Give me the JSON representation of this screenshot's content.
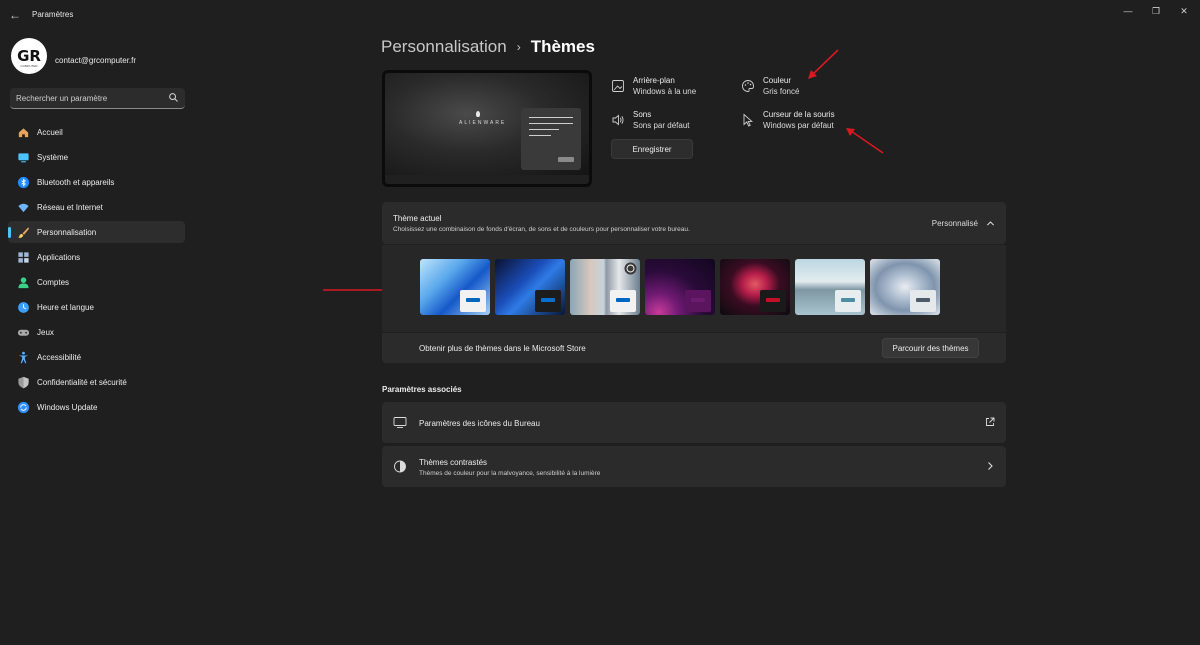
{
  "window": {
    "title": "Paramètres",
    "back_glyph": "←",
    "minimize_glyph": "—",
    "maximize_glyph": "❐",
    "close_glyph": "✕"
  },
  "account": {
    "avatar_mark": "GR",
    "avatar_sub": "COMPUTER",
    "email": "contact@grcomputer.fr"
  },
  "search": {
    "placeholder": "Rechercher un paramètre"
  },
  "sidebar": {
    "items": [
      {
        "label": "Accueil",
        "icon": "home-icon",
        "color": "#e8a35c"
      },
      {
        "label": "Système",
        "icon": "system-icon",
        "color": "#4cc2ff"
      },
      {
        "label": "Bluetooth et appareils",
        "icon": "bluetooth-icon",
        "color": "#1f8bff"
      },
      {
        "label": "Réseau et Internet",
        "icon": "wifi-icon",
        "color": "#6cb6ff"
      },
      {
        "label": "Personnalisation",
        "icon": "brush-icon",
        "color": "#e9a46a",
        "active": true
      },
      {
        "label": "Applications",
        "icon": "apps-icon",
        "color": "#9fb7d6"
      },
      {
        "label": "Comptes",
        "icon": "accounts-icon",
        "color": "#3bd187"
      },
      {
        "label": "Heure et langue",
        "icon": "globe-clock-icon",
        "color": "#3aa0ff"
      },
      {
        "label": "Jeux",
        "icon": "gamepad-icon",
        "color": "#a8a8a8"
      },
      {
        "label": "Accessibilité",
        "icon": "accessibility-icon",
        "color": "#5ab0ff"
      },
      {
        "label": "Confidentialité et sécurité",
        "icon": "shield-icon",
        "color": "#9a9a9a"
      },
      {
        "label": "Windows Update",
        "icon": "update-icon",
        "color": "#2f8fff"
      }
    ]
  },
  "breadcrumb": {
    "parent": "Personnalisation",
    "separator": "›",
    "current": "Thèmes"
  },
  "preview": {
    "brand": "ALIENWARE"
  },
  "properties": {
    "background": {
      "title": "Arrière-plan",
      "value": "Windows à la une",
      "icon": "image-icon"
    },
    "color": {
      "title": "Couleur",
      "value": "Gris foncé",
      "icon": "palette-icon"
    },
    "sounds": {
      "title": "Sons",
      "value": "Sons par défaut",
      "icon": "speaker-icon"
    },
    "cursor": {
      "title": "Curseur de la souris",
      "value": "Windows par défaut",
      "icon": "cursor-icon"
    },
    "save_label": "Enregistrer"
  },
  "current_theme": {
    "title": "Thème actuel",
    "subtitle": "Choisissez une combinaison de fonds d'écran, de sons et de couleurs pour personnaliser votre bureau.",
    "value": "Personnalisé",
    "themes": [
      {
        "name": "windows-light-theme",
        "accent": "#0067c0",
        "mini": "#f2f2f2"
      },
      {
        "name": "windows-dark-theme",
        "accent": "#0a6ed1",
        "mini": "#1c1c1c"
      },
      {
        "name": "windows-spotlight-theme",
        "accent": "#0067c0",
        "mini": "#f2f2f2"
      },
      {
        "name": "glow-theme",
        "accent": "#6b1c6f",
        "mini": "#5a155e"
      },
      {
        "name": "captured-motion-theme",
        "accent": "#c40f28",
        "mini": "#1a1a1a"
      },
      {
        "name": "sunrise-theme",
        "accent": "#4c8fa3",
        "mini": "#e8eef0"
      },
      {
        "name": "flow-theme",
        "accent": "#4d5b68",
        "mini": "#e6e9ec"
      }
    ],
    "store_label": "Obtenir plus de thèmes dans le Microsoft Store",
    "browse_label": "Parcourir des thèmes"
  },
  "related": {
    "title": "Paramètres associés",
    "items": [
      {
        "title": "Paramètres des icônes du Bureau",
        "subtitle": "",
        "icon": "desktop-icon",
        "action": "external-link-icon"
      },
      {
        "title": "Thèmes contrastés",
        "subtitle": "Thèmes de couleur pour la malvoyance, sensibilité à la lumière",
        "icon": "contrast-icon",
        "action": "chevron-right-icon"
      }
    ]
  },
  "colors": {
    "accent": "#4cc2ff",
    "annotation_arrow": "#d71920"
  }
}
